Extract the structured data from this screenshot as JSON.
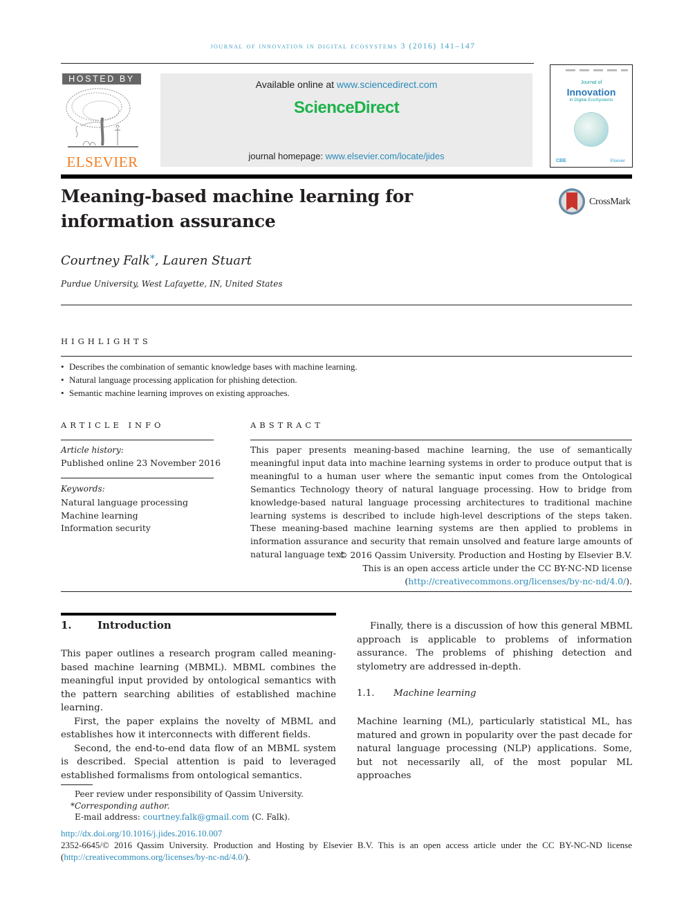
{
  "running_head": "journal of innovation in digital ecosystems 3 (2016) 141–147",
  "publisher": {
    "hosted_by": "HOSTED BY",
    "name": "ELSEVIER"
  },
  "sciencedirect": {
    "available_prefix": "Available online at ",
    "available_link": "www.sciencedirect.com",
    "logo": "ScienceDirect",
    "homepage_prefix": "journal homepage: ",
    "homepage_link": "www.elsevier.com/locate/jides"
  },
  "cover": {
    "line1": "Journal of",
    "line2": "Innovation",
    "line3": "in Digital EcoSystems",
    "cbe": "CBE",
    "publisher": "Elsevier"
  },
  "article": {
    "title": "Meaning-based machine learning for information assurance",
    "crossmark": "CrossMark",
    "author1": "Courtney Falk",
    "author1_mark": "*",
    "author_sep": ", ",
    "author2": "Lauren Stuart",
    "affiliation": "Purdue University, West Lafayette, IN, United States"
  },
  "highlights": {
    "heading": "HIGHLIGHTS",
    "bullet": "•",
    "items": [
      "Describes the combination of semantic knowledge bases with machine learning.",
      "Natural language processing application for phishing detection.",
      "Semantic machine learning improves on existing approaches."
    ]
  },
  "article_info": {
    "heading": "ARTICLE INFO",
    "history_label": "Article history:",
    "history_value": "Published online 23 November 2016",
    "keywords_label": "Keywords:",
    "keywords": [
      "Natural language processing",
      "Machine learning",
      "Information security"
    ]
  },
  "abstract": {
    "heading": "ABSTRACT",
    "text": "This paper presents meaning-based machine learning, the use of semantically meaningful input data into machine learning systems in order to produce output that is meaningful to a human user where the semantic input comes from the Ontological Semantics Technology theory of natural language processing. How to bridge from knowledge-based natural language processing architectures to traditional machine learning systems is described to include high-level descriptions of the steps taken. These meaning-based machine learning systems are then applied to problems in information assurance and security that remain unsolved and feature large amounts of natural language text.",
    "copyright": "© 2016 Qassim University. Production and Hosting by Elsevier B.V.",
    "license_line": "This is an open access article under the CC BY-NC-ND license",
    "license_open": "(",
    "license_link": "http://creativecommons.org/licenses/by-nc-nd/4.0/",
    "license_close": ")."
  },
  "body": {
    "section1_num": "1.",
    "section1_title": "Introduction",
    "left_paragraphs": [
      "This paper outlines a research program called meaning-based machine learning (MBML). MBML combines the meaningful input provided by ontological semantics with the pattern searching abilities of established machine learning.",
      "First, the paper explains the novelty of MBML and establishes how it interconnects with different fields.",
      "Second, the end-to-end data flow of an MBML system is described. Special attention is paid to leveraged established formalisms from ontological semantics."
    ],
    "right_paragraph1": "Finally, there is a discussion of how this general MBML approach is applicable to problems of information assurance. The problems of phishing detection and stylometry are addressed in-depth.",
    "subsection_num": "1.1.",
    "subsection_title": "Machine learning",
    "right_paragraph2": "Machine learning (ML), particularly statistical ML, has matured and grown in popularity over the past decade for natural language processing (NLP) applications. Some, but not necessarily all, of the most popular ML approaches"
  },
  "footnotes": {
    "peer_review": "Peer review under responsibility of Qassim University.",
    "star": "*",
    "corresponding": "Corresponding author.",
    "email_prefix": "E-mail address: ",
    "email": "courtney.falk@gmail.com",
    "email_suffix": " (C. Falk)."
  },
  "bottom": {
    "doi": "http://dx.doi.org/10.1016/j.jides.2016.10.007",
    "issn_line": "2352-6645/© 2016 Qassim University.  Production and Hosting by Elsevier B.V. This is an open access article under the CC BY-NC-ND license (",
    "license_link": "http://creativecommons.org/licenses/by-nc-nd/4.0/",
    "license_close": ")."
  }
}
